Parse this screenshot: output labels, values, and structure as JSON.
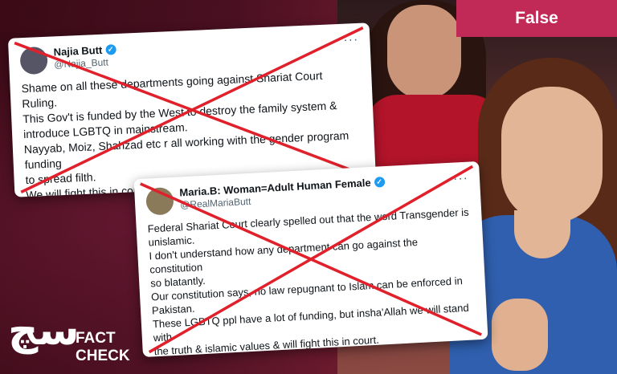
{
  "badge": {
    "label": "False",
    "color": "#c12a57"
  },
  "tweets": [
    {
      "display_name": "Najia Butt",
      "handle": "@Najia_Butt",
      "lines": [
        "Shame on all these departments going against Shariat Court Ruling.",
        "This Gov't is funded by the West to destroy the family system &",
        "introduce LGBTQ in mainstream.",
        "Nayyab, Moiz, Shahzad etc r all working with the gender program funding",
        "to spread filth.",
        "We will fight this in court."
      ]
    },
    {
      "display_name": "Maria.B: Woman=Adult Human Female",
      "handle": "@RealMariaButt",
      "lines": [
        "Federal Shariat Court clearly spelled out that the word Transgender is",
        "unislamic.",
        "I don't understand how any department can go against the constitution",
        "so blatantly.",
        "Our constitution says, no law repugnant to Islam can be enforced in",
        "Pakistan.",
        "These LGBTQ ppl have a lot of funding, but insha'Allah we will stand with",
        "the truth & islamic values & will fight this in court."
      ]
    }
  ],
  "logo": {
    "mark": "سچ",
    "line1": "FACT",
    "line2": "CHECK"
  },
  "icons": {
    "verified": "verified-badge-icon",
    "more": "more-options-icon",
    "cross": "red-x-icon"
  },
  "colors": {
    "cross": "#e0202a"
  }
}
